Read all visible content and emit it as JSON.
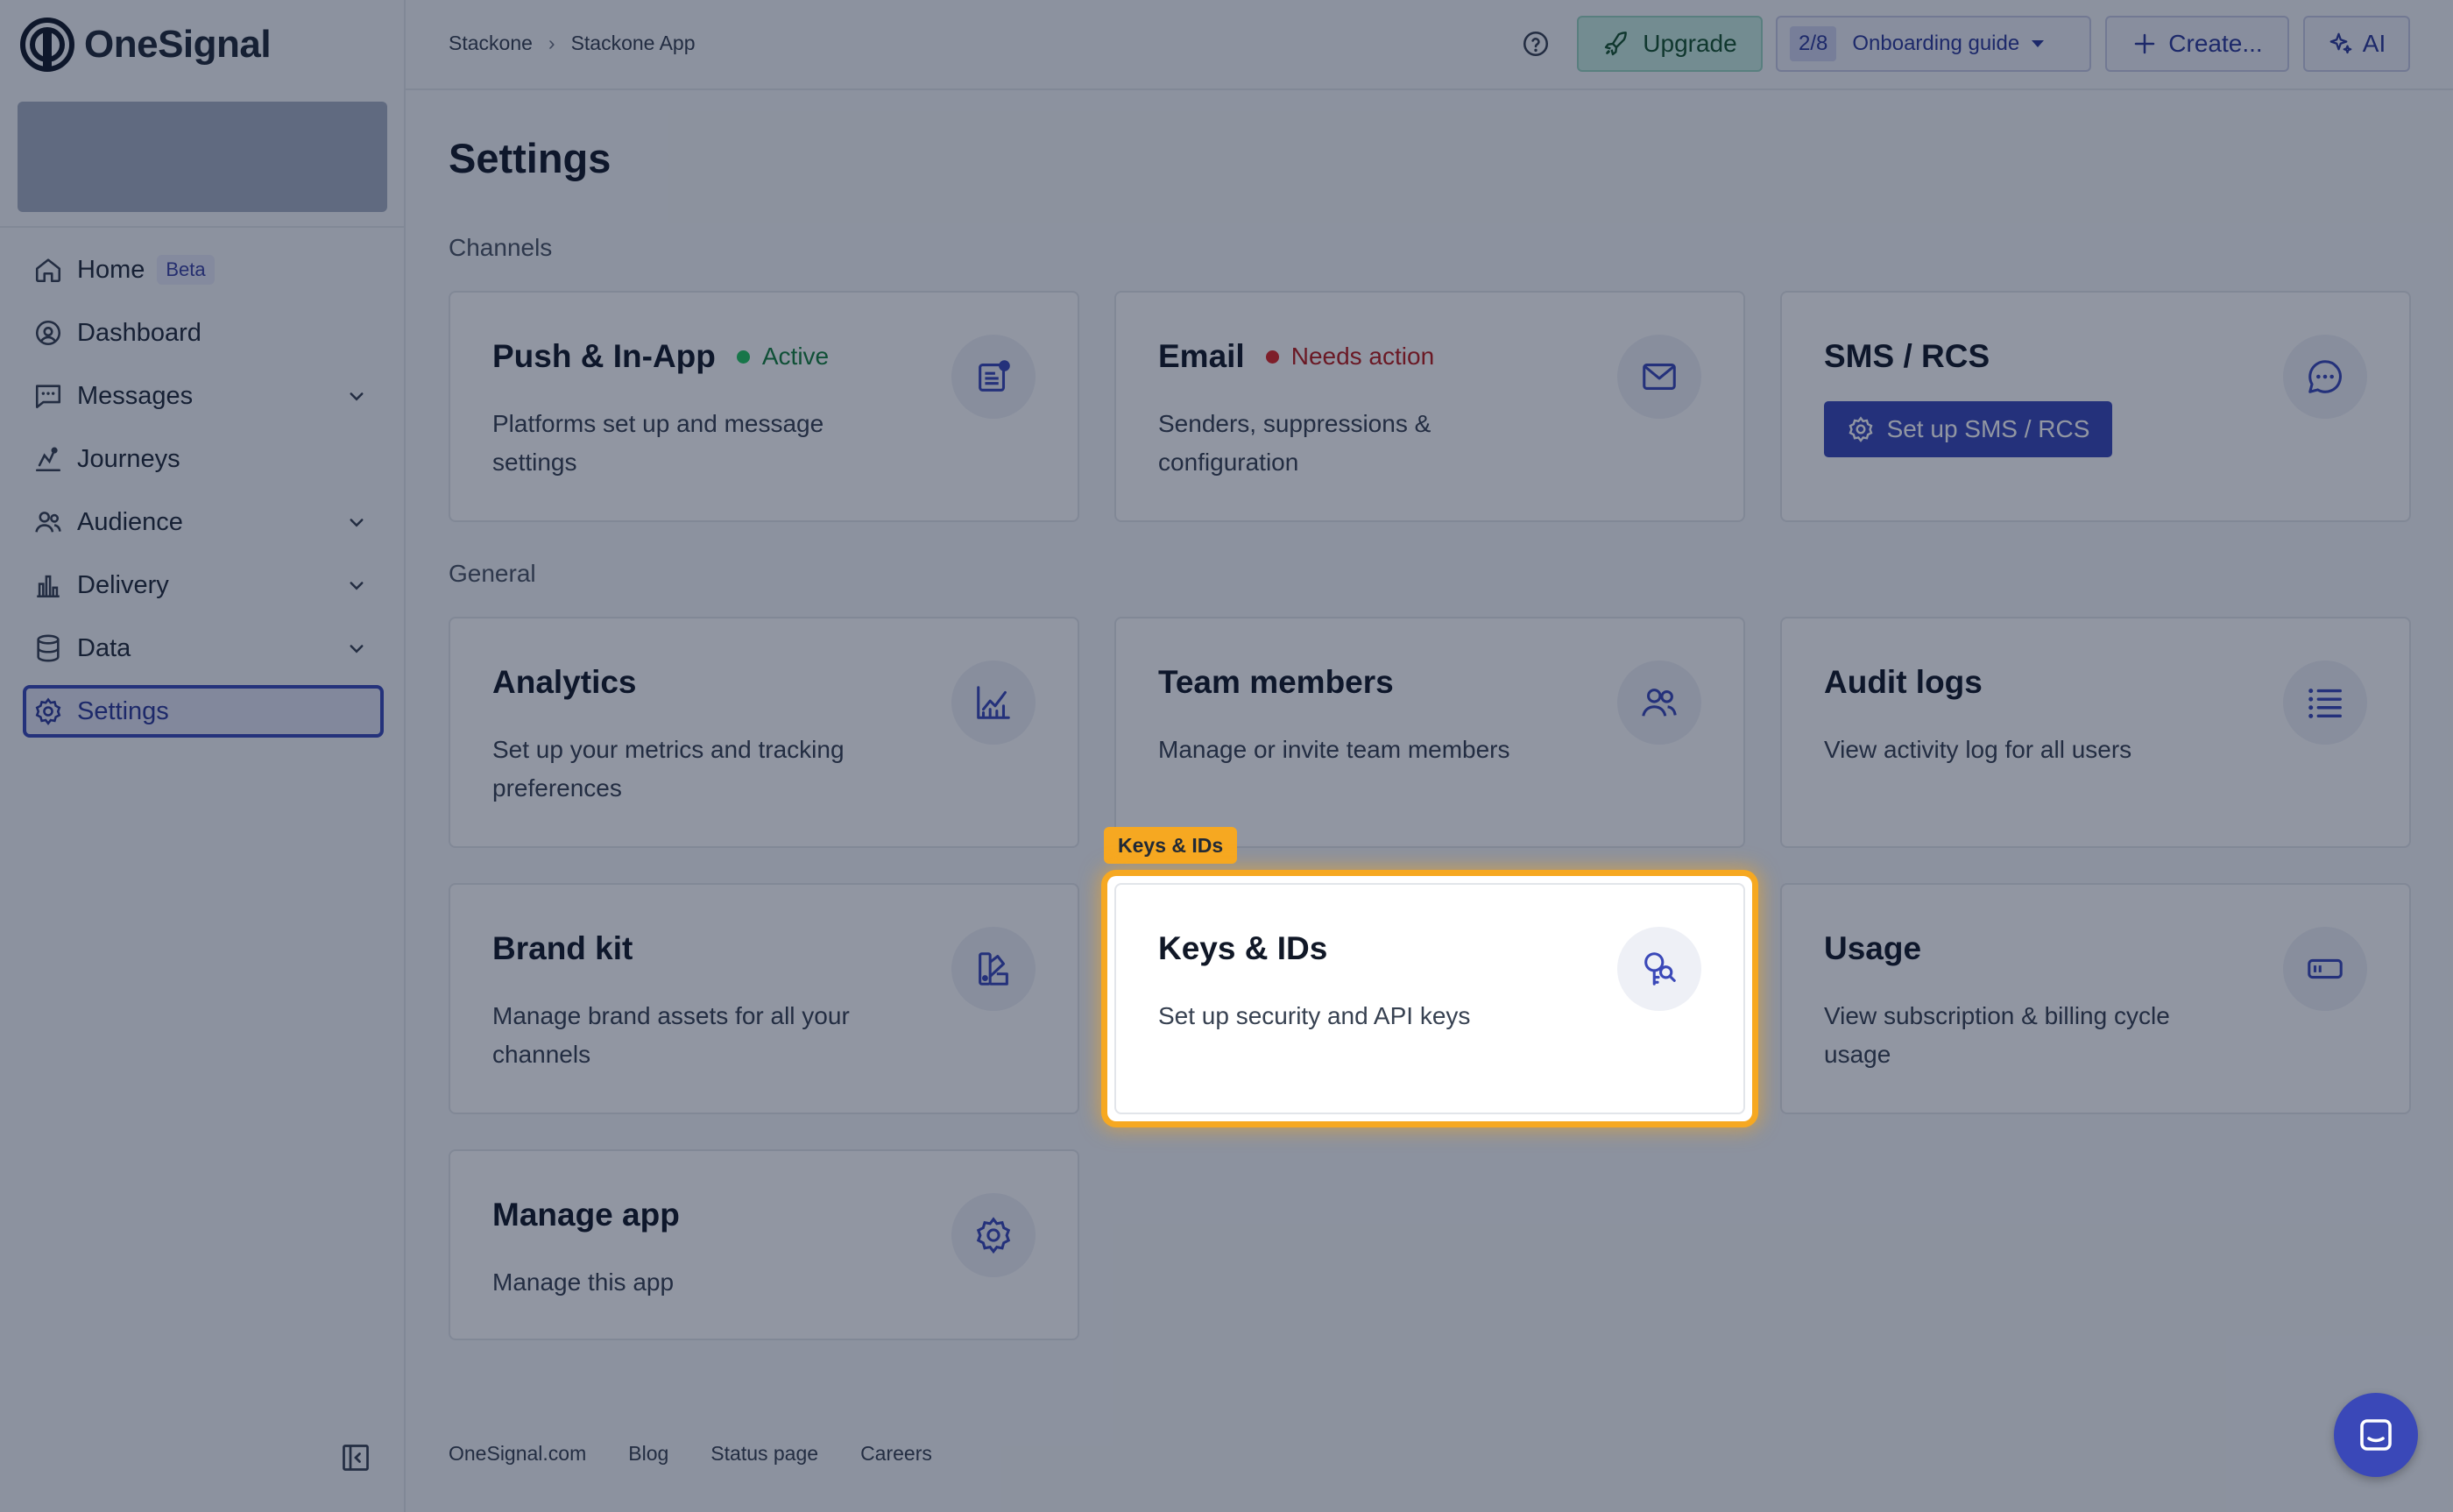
{
  "brand": {
    "name": "OneSignal"
  },
  "sidebar": {
    "items": [
      {
        "label": "Home",
        "badge": "Beta"
      },
      {
        "label": "Dashboard"
      },
      {
        "label": "Messages"
      },
      {
        "label": "Journeys"
      },
      {
        "label": "Audience"
      },
      {
        "label": "Delivery"
      },
      {
        "label": "Data"
      },
      {
        "label": "Settings"
      }
    ]
  },
  "header": {
    "breadcrumb": [
      "Stackone",
      "Stackone App"
    ],
    "upgrade_label": "Upgrade",
    "onboarding": {
      "count": "2/8",
      "label": "Onboarding guide"
    },
    "create_label": "Create...",
    "ai_label": "AI"
  },
  "main": {
    "title": "Settings",
    "channels_label": "Channels",
    "general_label": "General",
    "cards": {
      "push": {
        "title": "Push & In-App",
        "status": "Active",
        "desc": "Platforms set up and message settings"
      },
      "email": {
        "title": "Email",
        "status": "Needs action",
        "desc": "Senders, suppressions & configuration"
      },
      "sms": {
        "title": "SMS / RCS",
        "button": "Set up SMS / RCS"
      },
      "analytics": {
        "title": "Analytics",
        "desc": "Set up your metrics and tracking preferences"
      },
      "team": {
        "title": "Team members",
        "desc": "Manage or invite team members"
      },
      "audit": {
        "title": "Audit logs",
        "desc": "View activity log for all users"
      },
      "brand": {
        "title": "Brand kit",
        "desc": "Manage brand assets for all your channels"
      },
      "keys": {
        "title": "Keys & IDs",
        "desc": "Set up security and API keys"
      },
      "usage": {
        "title": "Usage",
        "desc": "View subscription & billing cycle usage"
      },
      "manage": {
        "title": "Manage app",
        "desc": "Manage this app"
      }
    }
  },
  "tooltip": {
    "label": "Keys & IDs"
  },
  "footer": {
    "links": [
      "OneSignal.com",
      "Blog",
      "Status page",
      "Careers"
    ]
  },
  "colors": {
    "accent": "#3a48b8",
    "highlight": "#f6a821",
    "active": "#22c55e",
    "needs_action": "#dc2626"
  }
}
